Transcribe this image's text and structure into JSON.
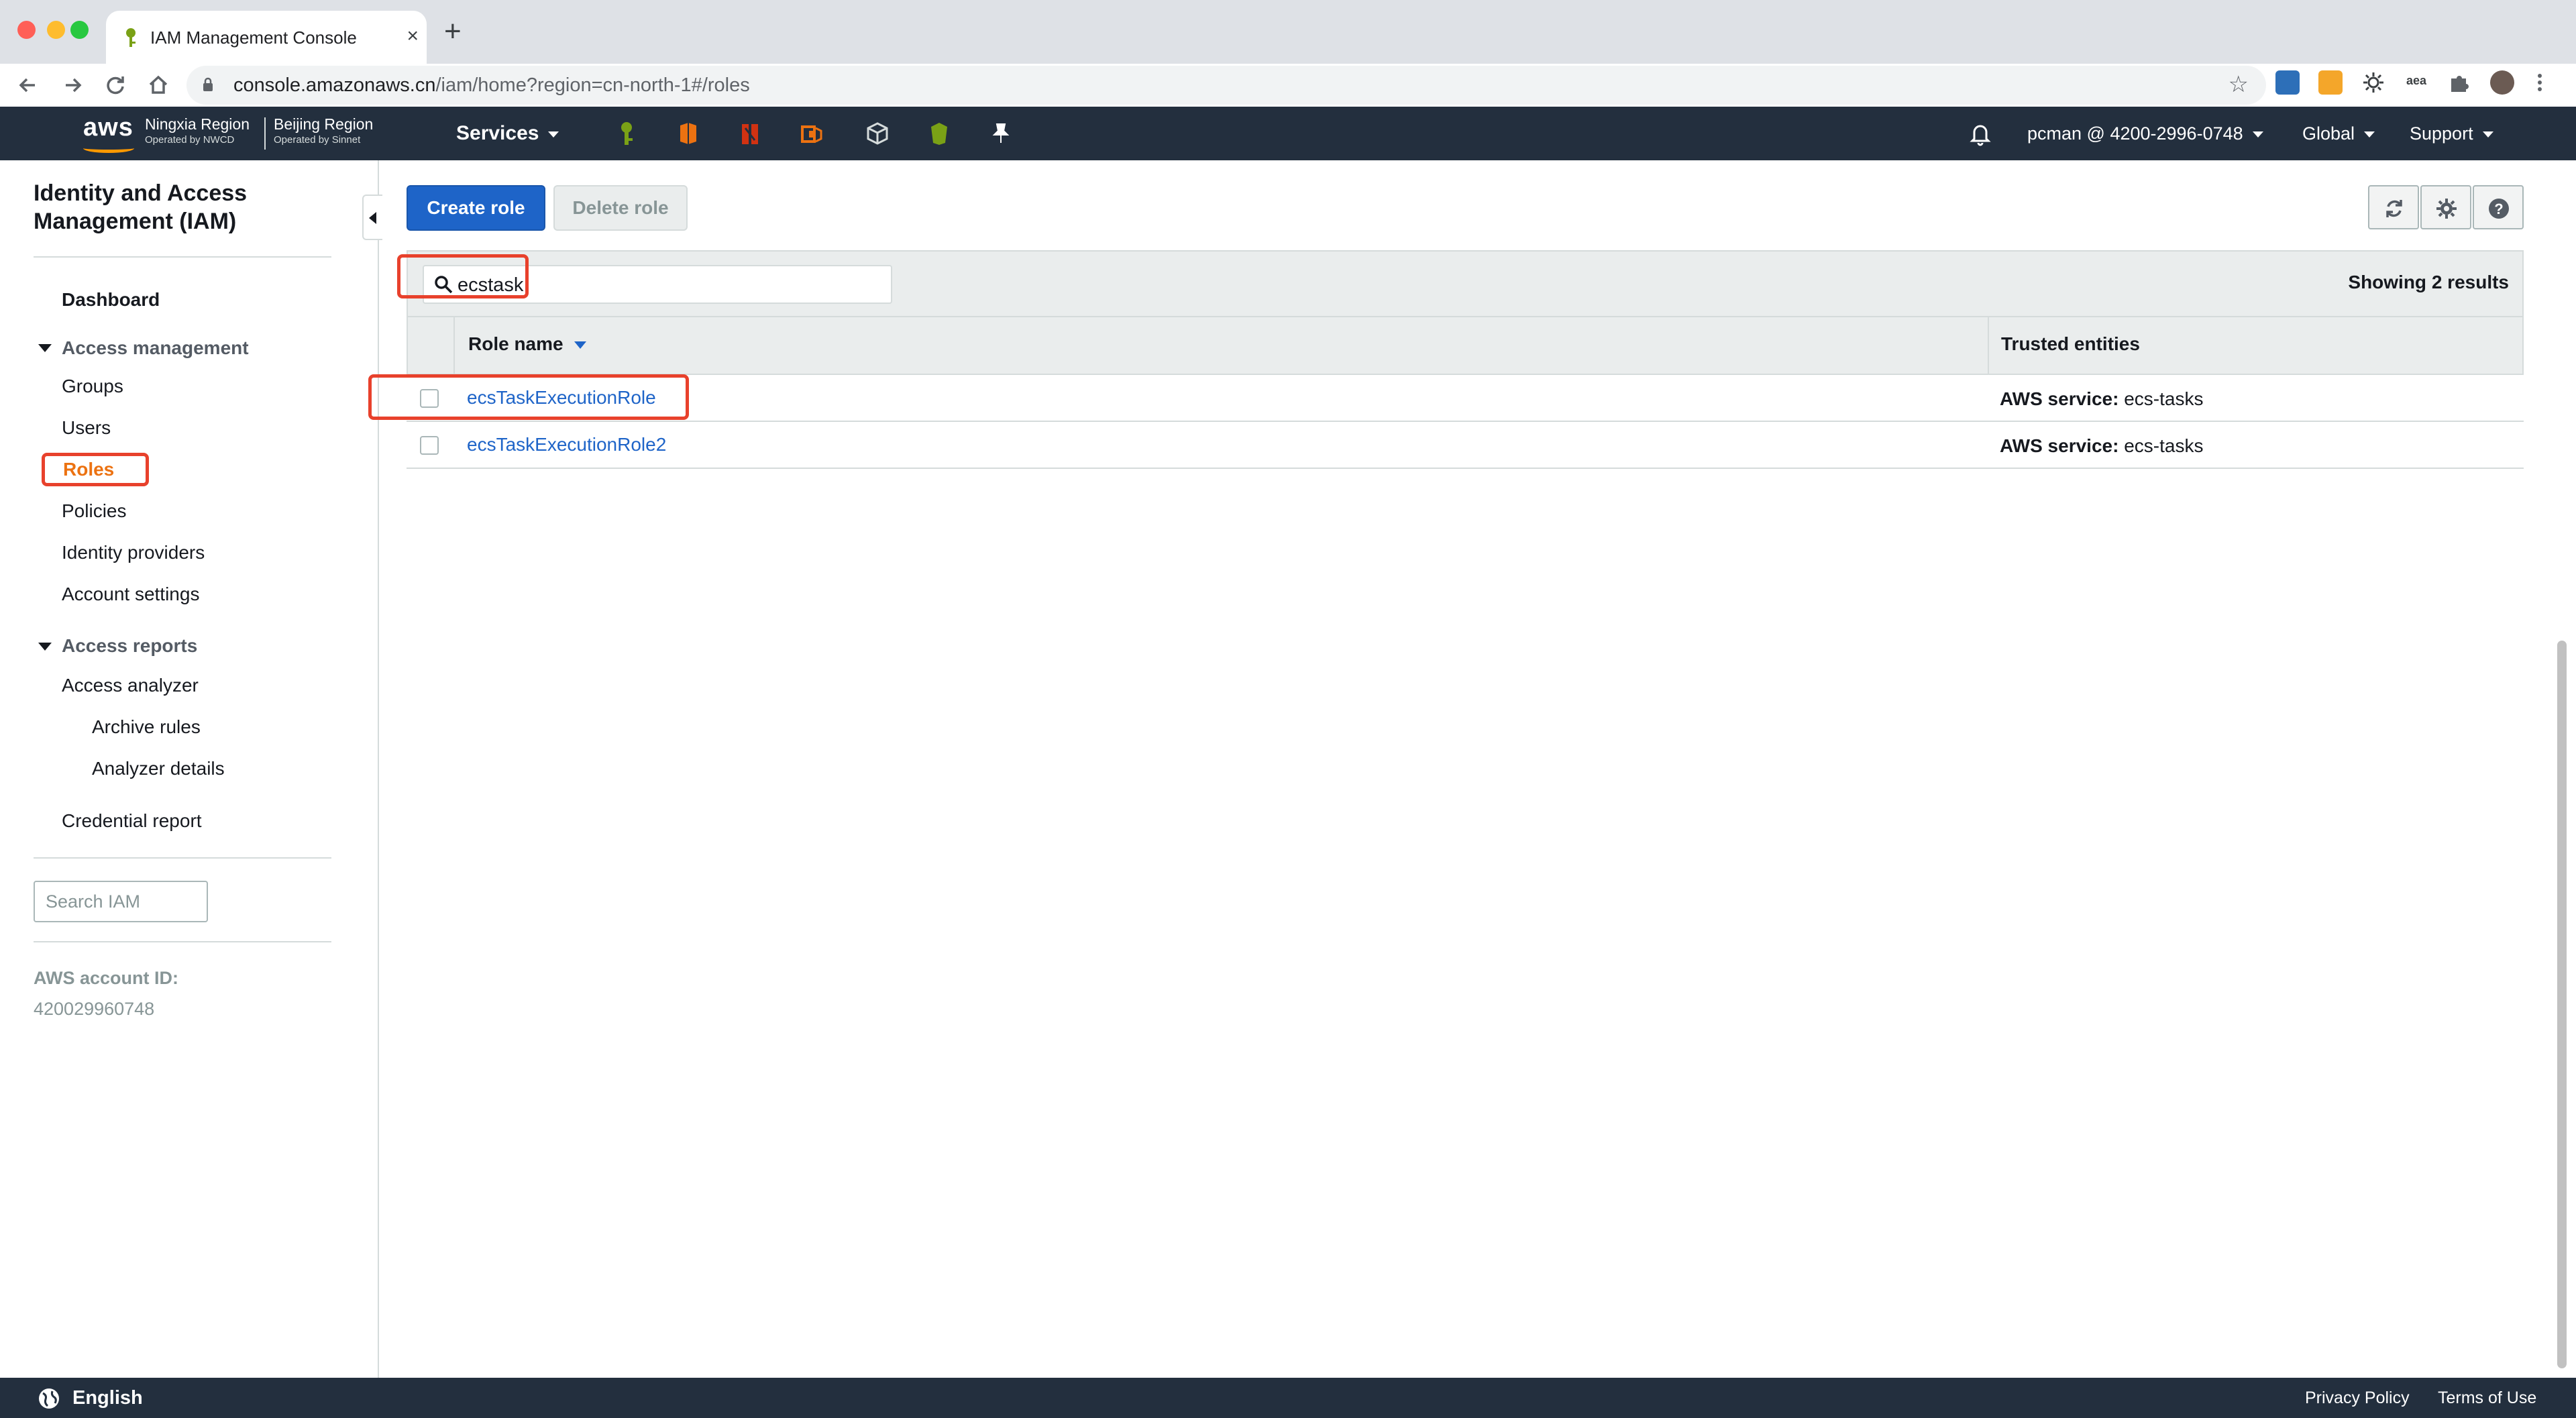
{
  "browser": {
    "tab_title": "IAM Management Console",
    "new_tab": "+",
    "close": "×",
    "url_host": "console.amazonaws.cn",
    "url_path": "/iam/home?region=cn-north-1#/roles",
    "extensions": [
      "s-extension-icon",
      "mail-extension-icon",
      "gear-extension-icon",
      "aea-extension-icon",
      "puzzle-icon",
      "profile-avatar",
      "kebab-menu-icon"
    ]
  },
  "aws_nav": {
    "logo": "aws",
    "region1_name": "Ningxia Region",
    "region1_op": "Operated by NWCD",
    "region2_name": "Beijing Region",
    "region2_op": "Operated by Sinnet",
    "services_label": "Services",
    "account_label": "pcman @ 4200-2996-0748",
    "global_label": "Global",
    "support_label": "Support"
  },
  "sidebar": {
    "title": "Identity and Access Management (IAM)",
    "dashboard": "Dashboard",
    "access_management": "Access management",
    "groups": "Groups",
    "users": "Users",
    "roles": "Roles",
    "policies": "Policies",
    "identity_providers": "Identity providers",
    "account_settings": "Account settings",
    "access_reports": "Access reports",
    "access_analyzer": "Access analyzer",
    "archive_rules": "Archive rules",
    "analyzer_details": "Analyzer details",
    "credential_report": "Credential report",
    "search_placeholder": "Search IAM",
    "account_id_label": "AWS account ID:",
    "account_id_value": "420029960748"
  },
  "main": {
    "create_role": "Create role",
    "delete_role": "Delete role",
    "filter_value": "ecstask",
    "showing": "Showing 2 results",
    "col_role_name": "Role name",
    "col_trusted": "Trusted entities",
    "rows": [
      {
        "role": "ecsTaskExecutionRole",
        "trust_label": "AWS service:",
        "trust_value": "ecs-tasks"
      },
      {
        "role": "ecsTaskExecutionRole2",
        "trust_label": "AWS service:",
        "trust_value": "ecs-tasks"
      }
    ]
  },
  "footer": {
    "language": "English",
    "privacy": "Privacy Policy",
    "terms": "Terms of Use"
  },
  "colors": {
    "aws_nav_bg": "#232f3e",
    "aws_orange": "#ff9900",
    "active_link": "#ec7211",
    "primary_blue": "#1e64c8",
    "highlight_red": "#e8412c"
  }
}
